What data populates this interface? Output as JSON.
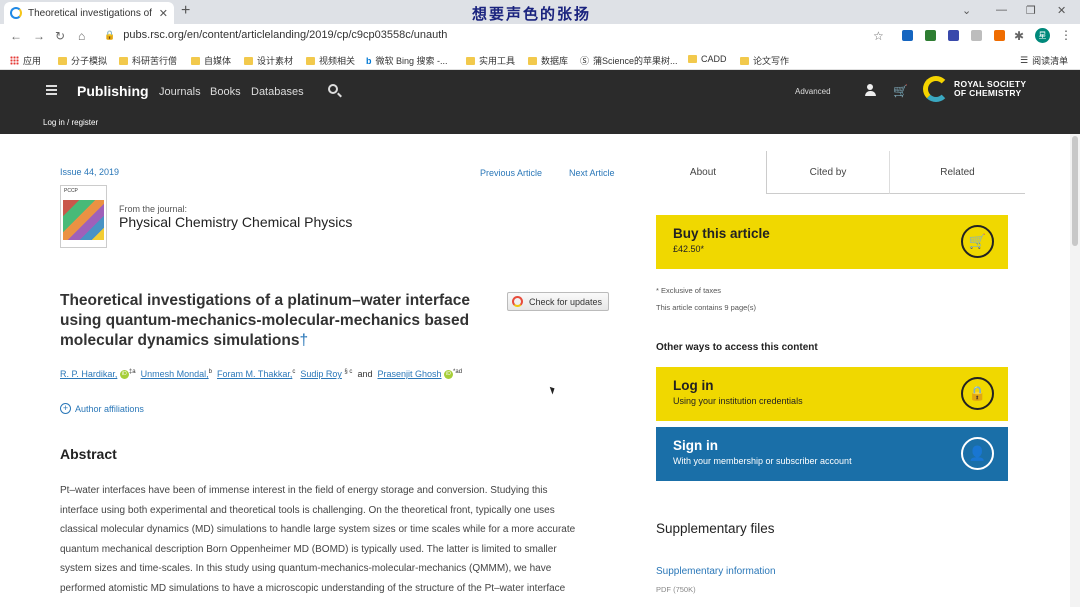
{
  "browser": {
    "tab_title": "Theoretical investigations of a",
    "tab_close": "✕",
    "new_tab": "+",
    "overlay_caption": "想要声色的张扬",
    "url": "pubs.rsc.org/en/content/articlelanding/2019/cp/c9cp03558c/unauth",
    "profile_initial": "星",
    "bookmarks": [
      {
        "label": "应用",
        "kind": "apps"
      },
      {
        "label": "分子模拟",
        "kind": "folder"
      },
      {
        "label": "科研苦行僧",
        "kind": "folder"
      },
      {
        "label": "自媒体",
        "kind": "folder"
      },
      {
        "label": "设计素材",
        "kind": "folder"
      },
      {
        "label": "视频相关",
        "kind": "folder"
      },
      {
        "label": "微软 Bing 搜索 -...",
        "kind": "bing"
      },
      {
        "label": "实用工具",
        "kind": "folder"
      },
      {
        "label": "数据库",
        "kind": "folder"
      },
      {
        "label": "蒲Science的苹果树...",
        "kind": "site"
      },
      {
        "label": "CADD",
        "kind": "folder"
      },
      {
        "label": "论文写作",
        "kind": "folder"
      }
    ],
    "reading_list": "阅读清单"
  },
  "header": {
    "brand": "Publishing",
    "nav": [
      "Journals",
      "Books",
      "Databases"
    ],
    "advanced": "Advanced",
    "logo_line1": "ROYAL SOCIETY",
    "logo_line2": "OF CHEMISTRY",
    "login": "Log in / register"
  },
  "article": {
    "issue": "Issue 44, 2019",
    "previous": "Previous Article",
    "next": "Next Article",
    "cover_label": "PCCP",
    "from_journal": "From the journal:",
    "journal": "Physical Chemistry Chemical Physics",
    "title": "Theoretical investigations of a platinum–water interface using quantum-mechanics-molecular-mechanics based molecular dynamics simulations",
    "title_mark": "†",
    "check_updates": "Check for updates",
    "authors": [
      {
        "name": "R. P. Hardikar,",
        "sup": "‡a",
        "orcid": true
      },
      {
        "name": "Unmesh Mondal,",
        "sup": "b",
        "orcid": false
      },
      {
        "name": "Foram M. Thakkar,",
        "sup": "c",
        "orcid": false
      },
      {
        "name": "Sudip Roy",
        "sup": "§ c",
        "orcid": false
      },
      {
        "name": "Prasenjit Ghosh",
        "sup": "*ad",
        "orcid": true
      }
    ],
    "and": "and",
    "affiliations": "Author affiliations",
    "abstract_heading": "Abstract",
    "abstract_lines": [
      "Pt–water interfaces have been of immense interest in the field of energy storage and conversion. Studying this",
      "interface using both experimental and theoretical tools is challenging. On the theoretical front, typically one uses",
      "classical molecular dynamics (MD) simulations to handle large system sizes or time scales while for a more accurate",
      "quantum mechanical description Born Oppenheimer MD (BOMD) is typically used. The latter is limited to smaller",
      "system sizes and time-scales. In this study using quantum-mechanics-molecular-mechanics (QMMM), we have",
      "performed atomistic MD simulations to have a microscopic understanding of the structure of the Pt–water interface"
    ]
  },
  "sidebar": {
    "tabs": [
      "About",
      "Cited by",
      "Related"
    ],
    "buy_title": "Buy this article",
    "buy_price": "£42.50*",
    "tax_note": "* Exclusive of taxes",
    "pages_note": "This article contains 9 page(s)",
    "other_ways": "Other ways to access this content",
    "login_title": "Log in",
    "login_sub": "Using your institution credentials",
    "signin_title": "Sign in",
    "signin_sub": "With your membership or subscriber account",
    "supp_heading": "Supplementary files",
    "supp_link": "Supplementary information",
    "supp_meta": "PDF (750K)"
  },
  "colors": {
    "accent_yellow": "#f0d800",
    "accent_blue": "#1a6fa8",
    "link": "#2a77b8",
    "header_bg": "#2b2b2b"
  }
}
